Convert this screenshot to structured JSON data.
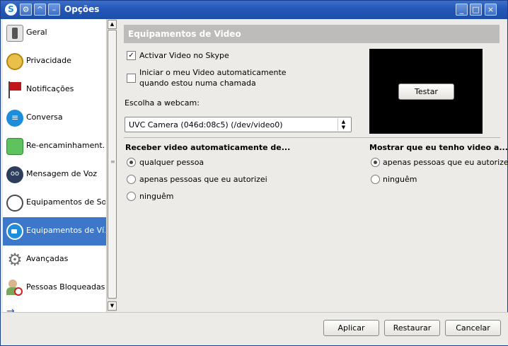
{
  "window": {
    "title": "Opções",
    "titlebar_buttons": [
      "minimize-icon",
      "maximize-icon",
      "close-icon"
    ],
    "left_buttons": [
      "skype-icon",
      "settings-icon",
      "up-arrow-icon",
      "dash-icon"
    ],
    "accent": "#2457b8"
  },
  "sidebar": {
    "items": [
      {
        "label": "Geral",
        "icon": "switch-icon",
        "color": "#6c6c6c"
      },
      {
        "label": "Privacidade",
        "icon": "lock-icon",
        "color": "#d8a31a"
      },
      {
        "label": "Notificações",
        "icon": "flag-icon",
        "color": "#c01818"
      },
      {
        "label": "Conversa",
        "icon": "chat-icon",
        "color": "#1c8edb"
      },
      {
        "label": "Re-encaminhament...",
        "icon": "forward-icon",
        "color": "#3aa53a"
      },
      {
        "label": "Mensagem de Voz",
        "icon": "voicemail-icon",
        "color": "#2c3e5c"
      },
      {
        "label": "Equipamentos de Som",
        "icon": "headset-icon",
        "color": "#4a4a4a"
      },
      {
        "label": "Equipamentos de Ví...",
        "icon": "video-icon",
        "color": "#1c8edb",
        "active": true
      },
      {
        "label": "Avançadas",
        "icon": "gear-icon",
        "color": "#707070"
      },
      {
        "label": "Pessoas Bloqueadas",
        "icon": "blocked-user-icon",
        "color": "#d02020"
      }
    ]
  },
  "video": {
    "header": "Equipamentos de Video",
    "activate_label": "Activar Video no Skype",
    "activate_checked": true,
    "autostart_line1": "Iniciar o meu Video automaticamente",
    "autostart_line2": "quando estou numa chamada",
    "autostart_checked": false,
    "webcam_label": "Escolha a webcam:",
    "webcam_value": "UVC Camera (046d:08c5) (/dev/video0)",
    "test_button": "Testar",
    "receive_heading": "Receber video automaticamente de...",
    "receive_options": [
      "qualquer pessoa",
      "apenas pessoas que eu autorizei",
      "ninguêm"
    ],
    "receive_selected": 0,
    "show_heading": "Mostrar que eu tenho video a...",
    "show_options": [
      "apenas pessoas que eu autorizei",
      "ninguêm"
    ],
    "show_selected": 0
  },
  "footer": {
    "apply": "Aplicar",
    "restore": "Restaurar",
    "cancel": "Cancelar"
  }
}
